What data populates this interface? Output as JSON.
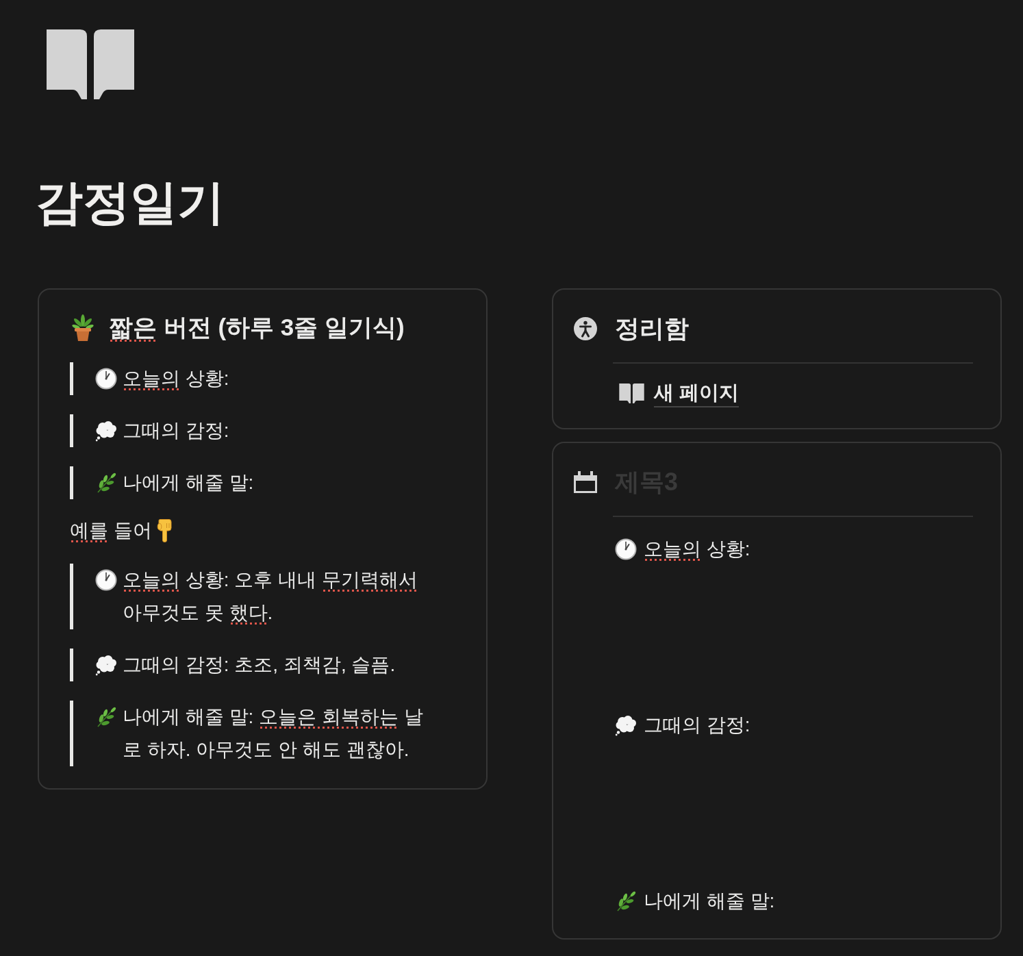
{
  "page": {
    "title": "감정일기"
  },
  "left_card": {
    "heading": {
      "segments": [
        {
          "text": "짧은",
          "misspelled": true
        },
        {
          "text": " 버전 (하루 3줄 일기식)",
          "misspelled": false
        }
      ]
    },
    "template": [
      {
        "kind": "situation",
        "segments": [
          {
            "text": "오늘의",
            "misspelled": true
          },
          {
            "text": " 상황:",
            "misspelled": false
          }
        ]
      },
      {
        "kind": "emotion",
        "segments": [
          {
            "text": "그때의 감정:",
            "misspelled": false
          }
        ]
      },
      {
        "kind": "advice",
        "segments": [
          {
            "text": "나에게 해줄 말:",
            "misspelled": false
          }
        ]
      }
    ],
    "example_label": {
      "segments": [
        {
          "text": "예를",
          "misspelled": true
        },
        {
          "text": " 들어",
          "misspelled": false
        }
      ]
    },
    "example": [
      {
        "kind": "situation",
        "segments": [
          {
            "text": "오늘의",
            "misspelled": true
          },
          {
            "text": " 상황: 오후 내내 ",
            "misspelled": false
          },
          {
            "text": "무기력해서",
            "misspelled": true
          },
          {
            "text": " 아무것도 못 ",
            "misspelled": false
          },
          {
            "text": "했다",
            "misspelled": true
          },
          {
            "text": ".",
            "misspelled": false
          }
        ]
      },
      {
        "kind": "emotion",
        "segments": [
          {
            "text": "그때의 감정: 초조, 죄책감, 슬픔.",
            "misspelled": false
          }
        ]
      },
      {
        "kind": "advice",
        "segments": [
          {
            "text": "나에게 해줄 말: ",
            "misspelled": false
          },
          {
            "text": "오늘은",
            "misspelled": true
          },
          {
            "text": " 회복하는",
            "misspelled": true
          },
          {
            "text": " 날로 하자. 아무것도 안 해도 괜찮아.",
            "misspelled": false
          }
        ]
      }
    ]
  },
  "inbox_card": {
    "title": "정리함",
    "links": [
      {
        "text": "새 페이지"
      }
    ]
  },
  "template_card": {
    "heading": {
      "placeholder": "제목3"
    },
    "items": [
      {
        "kind": "situation",
        "segments": [
          {
            "text": "오늘의",
            "misspelled": true
          },
          {
            "text": " 상황:",
            "misspelled": false
          }
        ]
      },
      {
        "kind": "emotion",
        "segments": [
          {
            "text": "그때의 감정:",
            "misspelled": false
          }
        ]
      },
      {
        "kind": "advice",
        "segments": [
          {
            "text": "나에게 해줄 말:",
            "misspelled": false
          }
        ]
      }
    ]
  }
}
